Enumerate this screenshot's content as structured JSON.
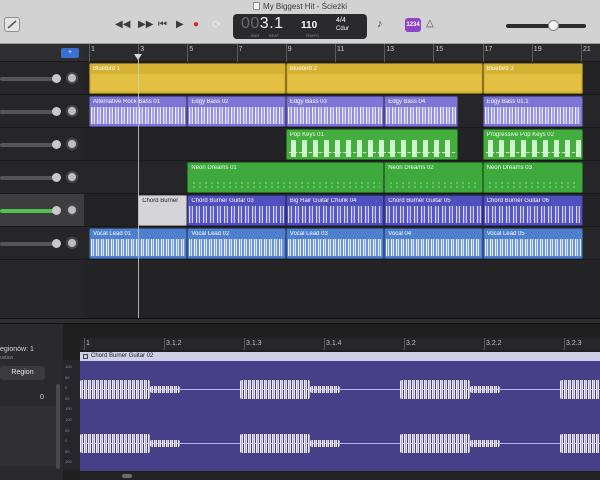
{
  "window": {
    "title": "My Biggest Hit - Ścieżki"
  },
  "transport": {
    "buttons": [
      {
        "name": "rewind-button",
        "glyph": "◀◀"
      },
      {
        "name": "fast-forward-button",
        "glyph": "▶▶"
      },
      {
        "name": "go-to-start-button",
        "glyph": "⏮"
      },
      {
        "name": "play-button",
        "glyph": "▶"
      },
      {
        "name": "record-button",
        "glyph": "●"
      },
      {
        "name": "cycle-button",
        "glyph": "⟳"
      }
    ],
    "accent_colors": {
      "record": "#e0262b",
      "cycle": "#e8e8e8"
    }
  },
  "lcd": {
    "position_dim": "00",
    "position": "3.1",
    "bar_label": "BAR",
    "beat_label": "BEAT",
    "tempo": "110",
    "tempo_label": "TEMPO",
    "time_signature": "4/4",
    "key": "Cdur"
  },
  "toolbar_right": {
    "count_in": "1234"
  },
  "header": {
    "add_track_label": "+"
  },
  "ruler": {
    "bars": [
      "1",
      "3",
      "5",
      "7",
      "9",
      "11",
      "13",
      "15",
      "17",
      "19",
      "21"
    ]
  },
  "tracks": [
    {
      "kind": "drum",
      "regions": [
        {
          "name": "Bluebird 1",
          "start": 1,
          "end": 9
        },
        {
          "name": "Bluebird 2",
          "start": 9,
          "end": 17
        },
        {
          "name": "Bluebird 3",
          "start": 17,
          "end": 21.1
        }
      ]
    },
    {
      "kind": "bass",
      "regions": [
        {
          "name": "Alternative Rock Bass 01",
          "start": 1,
          "end": 5
        },
        {
          "name": "Edgy Bass 02",
          "start": 5,
          "end": 9
        },
        {
          "name": "Edgy Bass 03",
          "start": 9,
          "end": 13
        },
        {
          "name": "Edgy Bass 04",
          "start": 13,
          "end": 16
        },
        {
          "name": "Edgy Bass 01.1",
          "start": 17,
          "end": 21.1
        }
      ]
    },
    {
      "kind": "keys",
      "regions": [
        {
          "name": "Pop Keys 01",
          "start": 9,
          "end": 16
        },
        {
          "name": "Progressive Pop Keys 02",
          "start": 17,
          "end": 21.1
        }
      ]
    },
    {
      "kind": "strings",
      "regions": [
        {
          "name": "Neon Dreams 01",
          "start": 5,
          "end": 13
        },
        {
          "name": "Neon Dreams 02",
          "start": 13,
          "end": 17
        },
        {
          "name": "Neon Dreams 03",
          "start": 17,
          "end": 21.1
        }
      ]
    },
    {
      "kind": "guitar",
      "regions": [
        {
          "name": "Chord Burner",
          "start": 3,
          "end": 5,
          "light": true
        },
        {
          "name": "Chord Burner Guitar 03",
          "start": 5,
          "end": 9
        },
        {
          "name": "Big Hair Guitar Chunk 04",
          "start": 9,
          "end": 13
        },
        {
          "name": "Chord Burner Guitar 05",
          "start": 13,
          "end": 17
        },
        {
          "name": "Chord Burner Guitar 06",
          "start": 17,
          "end": 21.1
        }
      ]
    },
    {
      "kind": "vocal",
      "regions": [
        {
          "name": "Vocal Lead 01",
          "start": 1,
          "end": 5
        },
        {
          "name": "Vocal Lead 02",
          "start": 5,
          "end": 9
        },
        {
          "name": "Vocal Lead 03",
          "start": 9,
          "end": 13
        },
        {
          "name": "Vocal 04",
          "start": 13,
          "end": 17
        },
        {
          "name": "Vocal Lead 05",
          "start": 17,
          "end": 21.1
        }
      ]
    }
  ],
  "playhead_bar": 3,
  "editor": {
    "region_count": "egionów: 1",
    "sub": "ustaw",
    "tab_label": "Region",
    "value": "0",
    "ruler_ticks": [
      "1",
      "3.1.2",
      "3.1.3",
      "3.1.4",
      "3.2",
      "3.2.2",
      "3.2.3"
    ],
    "region_name": "Chord Burner Guitar 02",
    "scale_labels": [
      "100",
      "50",
      "0",
      "50",
      "100",
      "100",
      "50",
      "0",
      "50",
      "100"
    ]
  }
}
